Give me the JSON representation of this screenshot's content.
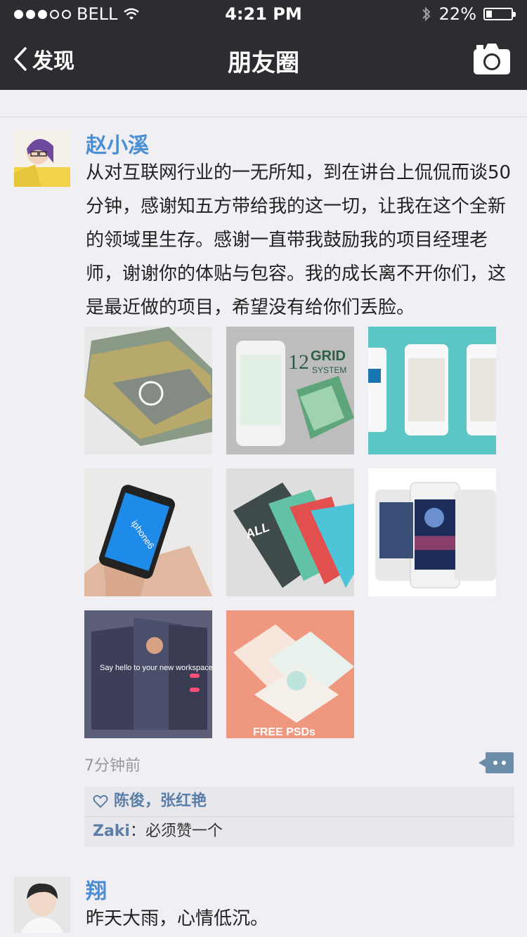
{
  "status_bar": {
    "carrier": "BELL",
    "time": "4:21 PM",
    "battery": "22%",
    "battery_level": 0.22
  },
  "nav": {
    "back_label": "发现",
    "title": "朋友圈"
  },
  "posts": [
    {
      "name": "赵小溪",
      "text": "从对互联网行业的一无所知，到在讲台上侃侃而谈50分钟，感谢知五方带给我的这一切，让我在这个全新的领域里生存。感谢一直带我鼓励我的项目经理老师，谢谢你的体贴与包容。我的成长离不开你们，这是最近做的项目，希望没有给你们丢脸。",
      "time": "7分钟前",
      "likes": "陈俊，张红艳",
      "comment": {
        "author": "Zaki",
        "separator": "：",
        "text": "必须赞一个"
      },
      "thumb_texts": {
        "grid12": "12",
        "grid_word": "GRID",
        "grid_system": "SYSTEM",
        "iphone6": "iphone6",
        "tech_all": "ALL",
        "say_hello": "Say hello to your new workspace",
        "free_psds": "FREE PSDs"
      }
    },
    {
      "name": "翔",
      "text": "昨天大雨，心情低沉。"
    }
  ],
  "colors": {
    "nav_bg": "#2c2c31",
    "name_blue": "#4a8fd4",
    "like_blue": "#5a7ea8",
    "page_bg": "#efeff4"
  }
}
